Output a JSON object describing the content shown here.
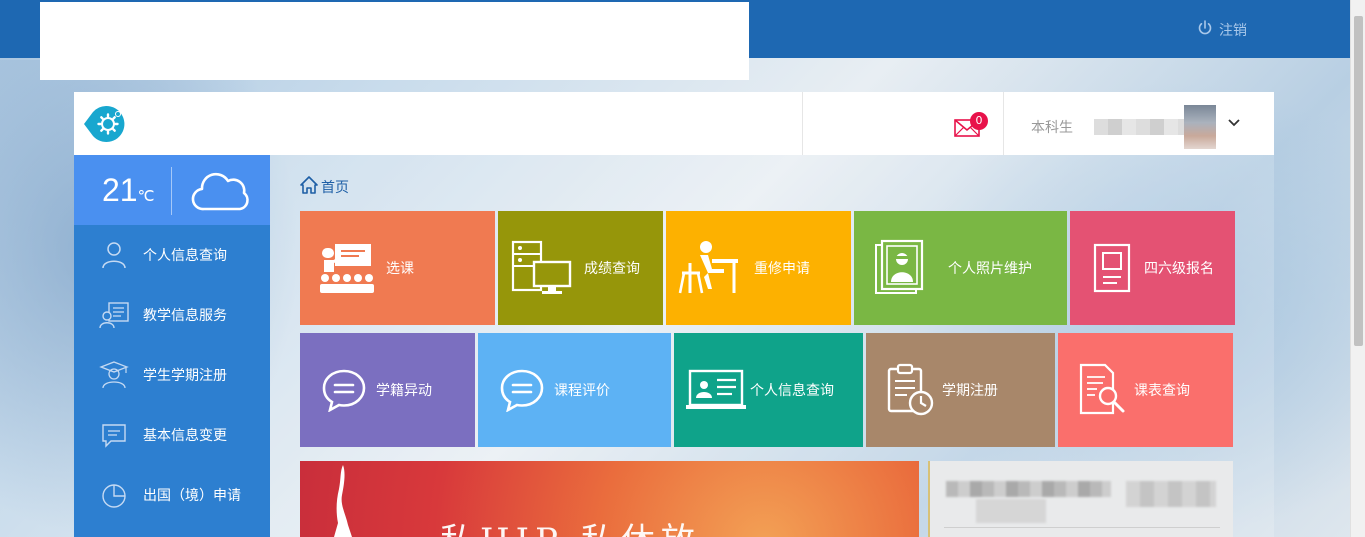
{
  "topbar": {
    "logout_label": "注销"
  },
  "header": {
    "mail_count": "0",
    "role": "本科生"
  },
  "weather": {
    "temp": "21",
    "unit": "℃"
  },
  "sidebar": {
    "items": [
      {
        "label": "个人信息查询",
        "icon": "person-icon"
      },
      {
        "label": "教学信息服务",
        "icon": "teaching-info-icon"
      },
      {
        "label": "学生学期注册",
        "icon": "graduate-icon"
      },
      {
        "label": "基本信息变更",
        "icon": "message-edit-icon"
      },
      {
        "label": "出国（境）申请",
        "icon": "pie-chart-icon"
      }
    ]
  },
  "breadcrumb": {
    "home": "首页"
  },
  "tiles_row1": [
    {
      "label": "选课",
      "color": "#f07a51",
      "icon": "classroom-icon"
    },
    {
      "label": "成绩查询",
      "color": "#96960a",
      "icon": "computer-icon"
    },
    {
      "label": "重修申请",
      "color": "#fdb100",
      "icon": "desk-study-icon"
    },
    {
      "label": "个人照片维护",
      "color": "#7ab744",
      "icon": "photo-icon"
    },
    {
      "label": "四六级报名",
      "color": "#e45273",
      "icon": "document-icon"
    }
  ],
  "tiles_row2": [
    {
      "label": "学籍异动",
      "color": "#7b6fc0",
      "icon": "chat-icon"
    },
    {
      "label": "课程评价",
      "color": "#5db2f4",
      "icon": "chat-icon"
    },
    {
      "label": "个人信息查询",
      "color": "#0fa38a",
      "icon": "id-card-icon"
    },
    {
      "label": "学期注册",
      "color": "#a8876a",
      "icon": "clipboard-clock-icon"
    },
    {
      "label": "课表查询",
      "color": "#fa6f6c",
      "icon": "search-document-icon"
    }
  ],
  "banner": {
    "art_text": "私HIP 私休放"
  }
}
